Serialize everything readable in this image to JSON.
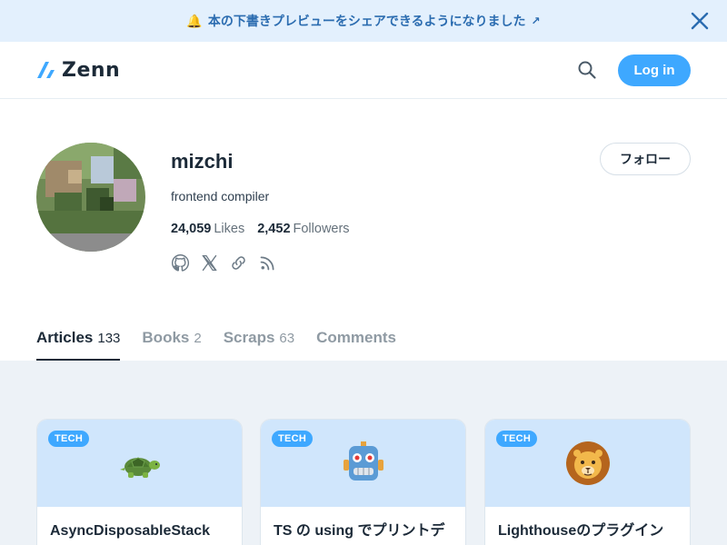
{
  "banner": {
    "icon": "bell-icon",
    "text": "本の下書きプレビューをシェアできるようになりました",
    "arrow": "↗",
    "close_icon": "close-icon"
  },
  "header": {
    "logo_text": "Zenn",
    "search_icon": "search-icon",
    "login_label": "Log in"
  },
  "profile": {
    "name": "mizchi",
    "bio": "frontend compiler",
    "likes_count": "24,059",
    "likes_label": "Likes",
    "followers_count": "2,452",
    "followers_label": "Followers",
    "follow_label": "フォロー",
    "social_icons": [
      "github-icon",
      "x-icon",
      "link-icon",
      "rss-icon"
    ]
  },
  "tabs": [
    {
      "label": "Articles",
      "count": "133",
      "active": true
    },
    {
      "label": "Books",
      "count": "2",
      "active": false
    },
    {
      "label": "Scraps",
      "count": "63",
      "active": false
    },
    {
      "label": "Comments",
      "count": "",
      "active": false
    }
  ],
  "cards": [
    {
      "badge": "TECH",
      "emoji": "turtle-emoji",
      "title": "AsyncDisposableStack"
    },
    {
      "badge": "TECH",
      "emoji": "robot-emoji",
      "title": "TS の using でプリントデ"
    },
    {
      "badge": "TECH",
      "emoji": "lion-emoji",
      "title": "Lighthouseのプラグイン"
    }
  ],
  "colors": {
    "accent": "#3ea8ff",
    "banner_bg": "#e3f0fd",
    "card_hero_bg": "#d0e6fc",
    "content_bg": "#edf2f7",
    "text": "#1c2a38"
  }
}
